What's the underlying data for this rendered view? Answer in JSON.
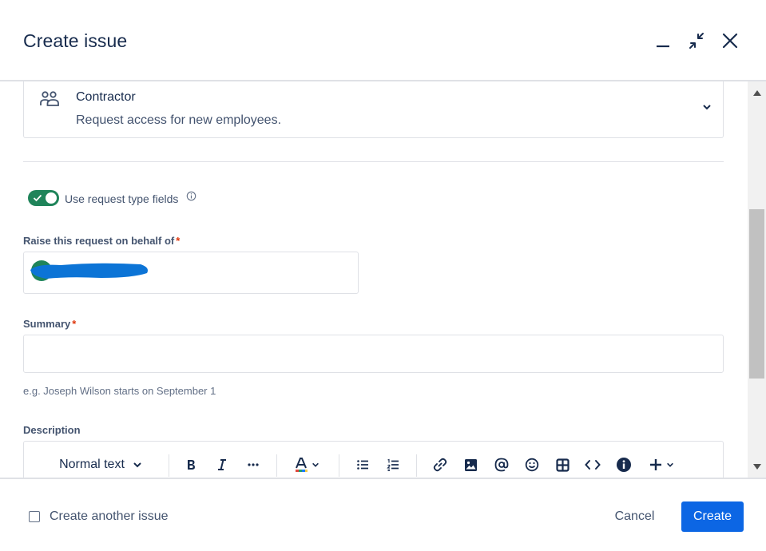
{
  "dialog": {
    "title": "Create issue"
  },
  "request_type": {
    "name": "Contractor",
    "description": "Request access for new employees."
  },
  "toggle": {
    "label": "Use request type fields",
    "enabled": true
  },
  "fields": {
    "behalf_label": "Raise this request on behalf of",
    "required_marker": "*",
    "summary_label": "Summary",
    "summary_value": "",
    "summary_helper": "e.g. Joseph Wilson starts on September 1",
    "description_label": "Description"
  },
  "editor_toolbar": {
    "text_style": "Normal text"
  },
  "footer": {
    "create_another_label": "Create another issue",
    "create_another_checked": false,
    "cancel_label": "Cancel",
    "create_label": "Create"
  },
  "colors": {
    "primary": "#0c66e4",
    "toggle_on": "#1f845a",
    "required": "#de350b",
    "text": "#172b4d"
  }
}
